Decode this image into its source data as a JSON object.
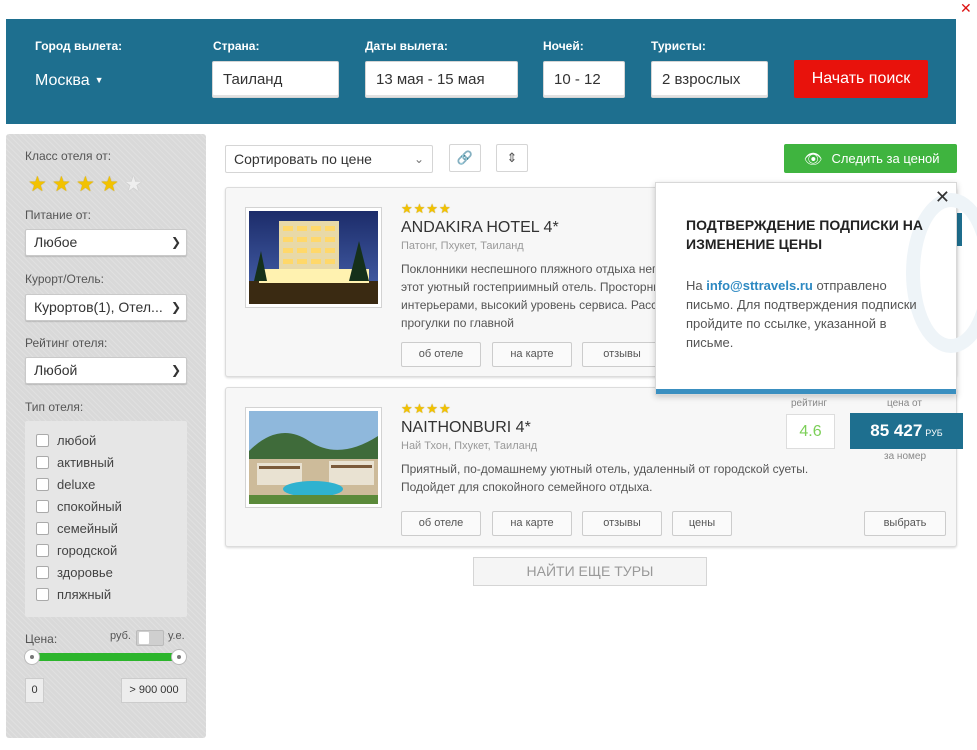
{
  "search": {
    "city_label": "Город вылета:",
    "city_value": "Москва",
    "country_label": "Страна:",
    "country_value": "Таиланд",
    "dates_label": "Даты вылета:",
    "dates_value": "13 мая - 15 мая",
    "nights_label": "Ночей:",
    "nights_value": "10 - 12",
    "tourists_label": "Туристы:",
    "tourists_value": "2 взрослых",
    "search_button": "Начать поиск"
  },
  "filters": {
    "hotel_class_label": "Класс отеля от:",
    "hotel_class_stars": 4,
    "meals_label": "Питание от:",
    "meals_value": "Любое",
    "resort_label": "Курорт/Отель:",
    "resort_value": "Курортов(1), Отел...",
    "rating_label": "Рейтинг отеля:",
    "rating_value": "Любой",
    "type_label": "Тип отеля:",
    "types": [
      "любой",
      "активный",
      "deluxe",
      "спокойный",
      "семейный",
      "городской",
      "здоровье",
      "пляжный"
    ],
    "price_label": "Цена:",
    "currency_rub": "руб.",
    "currency_ue": "у.е.",
    "price_min": "0",
    "price_max": "> 900 000"
  },
  "toolbar": {
    "sort_value": "Сортировать по цене",
    "watch_button": "Следить за ценой"
  },
  "hotels": [
    {
      "stars": "★★★★",
      "name": "ANDAKIRA HOTEL 4*",
      "location": "Патонг, Пхукет, Таиланд",
      "description": "Поклонники неспешного пляжного отдыха непременно оценят по достоинству этот уютный гостеприимный отель. Просторные номера с яркими интерьерами, высокий уровень сервиса. Расстояние до моря – минут 10-15 прогулки по главной",
      "btn_about": "об отеле",
      "btn_map": "на карте",
      "btn_reviews": "отзывы"
    },
    {
      "stars": "★★★★",
      "name": "NAITHONBURI 4*",
      "location": "Най Тхон, Пхукет, Таиланд",
      "description": "Приятный, по-домашнему уютный отель, удаленный от городской суеты. Подойдет для спокойного семейного отдыха.",
      "btn_about": "об отеле",
      "btn_map": "на карте",
      "btn_reviews": "отзывы",
      "btn_prices": "цены",
      "btn_choose": "выбрать",
      "rating_caption": "рейтинг",
      "rating_value": "4.6",
      "price_caption": "цена от",
      "price_value": "85 427",
      "price_currency": "РУБ",
      "price_per": "за номер"
    }
  ],
  "more_button": "НАЙТИ ЕЩЕ ТУРЫ",
  "popup": {
    "title": "Подтверждение подписки на изменение цены",
    "text_prefix": "На ",
    "email": "info@sttravels.ru",
    "text_suffix": " отправлено письмо. Для подтверждения подписки пройдите по ссылке, указанной в письме.",
    "close": "✕"
  },
  "colors": {
    "header_bg": "#1e6f8f",
    "search_button": "#e8120c",
    "watch_button": "#3fb43f",
    "rating_text": "#7ccf58",
    "email_link": "#2d89c2"
  }
}
